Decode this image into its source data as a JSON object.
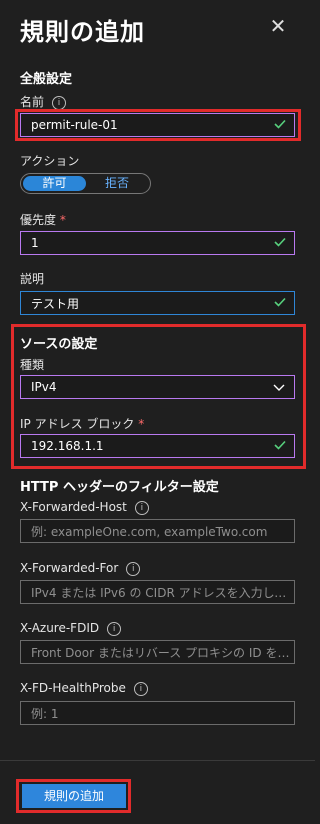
{
  "panel": {
    "title": "規則の追加",
    "close_icon": "close-icon"
  },
  "general": {
    "heading": "全般設定",
    "name_label": "名前",
    "name_value": "permit-rule-01",
    "action_label": "アクション",
    "action_options": [
      "許可",
      "拒否"
    ],
    "action_selected": "許可",
    "priority_label": "優先度",
    "priority_required": "*",
    "priority_value": "1",
    "description_label": "説明",
    "description_value": "テスト用"
  },
  "source": {
    "heading": "ソースの設定",
    "type_label": "種類",
    "type_value": "IPv4",
    "ip_label": "IP アドレス ブロック",
    "ip_required": "*",
    "ip_value": "192.168.1.1"
  },
  "http_filter": {
    "heading": "HTTP ヘッダーのフィルター設定",
    "fields": [
      {
        "label": "X-Forwarded-Host",
        "placeholder": "例: exampleOne.com, exampleTwo.com"
      },
      {
        "label": "X-Forwarded-For",
        "placeholder": "IPv4 または IPv6 の CIDR アドレスを入力してくだ..."
      },
      {
        "label": "X-Azure-FDID",
        "placeholder": "Front Door またはリバース プロキシの ID を入力..."
      },
      {
        "label": "X-FD-HealthProbe",
        "placeholder": "例: 1"
      }
    ]
  },
  "footer": {
    "submit_label": "規則の追加"
  },
  "colors": {
    "highlight_red": "#e12b2b",
    "valid_border": "#b979f0",
    "focus_border": "#2f86d6",
    "check_green": "#57d07d",
    "primary_blue": "#2e86dc"
  },
  "icons": [
    "info-icon",
    "checkmark-icon",
    "chevron-down-icon",
    "close-icon"
  ]
}
